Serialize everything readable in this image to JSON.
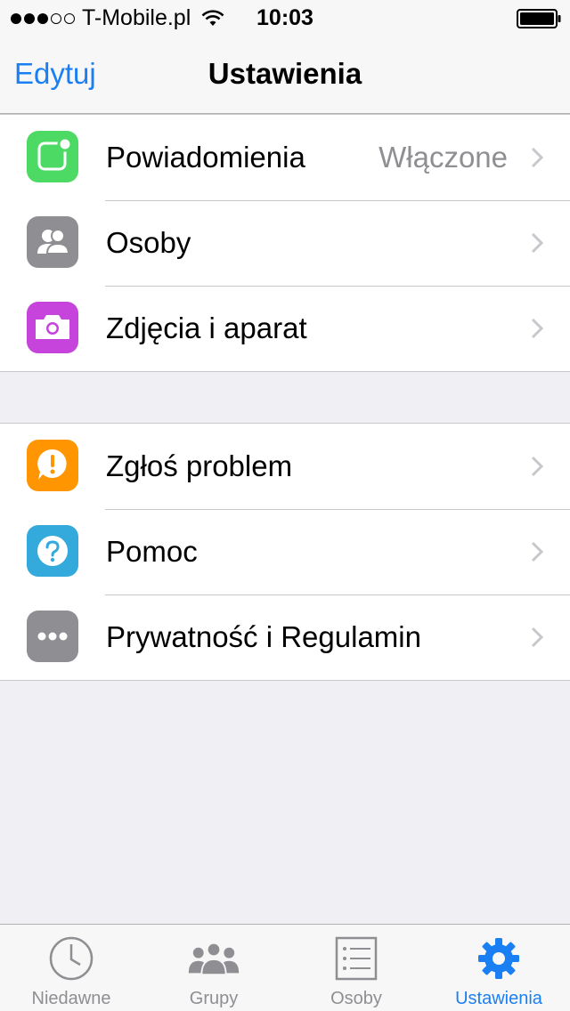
{
  "status_bar": {
    "signal_filled": 3,
    "signal_empty": 2,
    "carrier": "T-Mobile.pl",
    "time": "10:03"
  },
  "nav": {
    "left_button": "Edytuj",
    "title": "Ustawienia"
  },
  "groups": [
    {
      "items": [
        {
          "label": "Powiadomienia",
          "value": "Włączone",
          "icon": "notifications-icon",
          "color": "#4cd964"
        },
        {
          "label": "Osoby",
          "value": "",
          "icon": "contacts-icon",
          "color": "#8e8e93"
        },
        {
          "label": "Zdjęcia i aparat",
          "value": "",
          "icon": "camera-icon",
          "color": "#c644dc"
        }
      ]
    },
    {
      "items": [
        {
          "label": "Zgłoś problem",
          "value": "",
          "icon": "report-problem-icon",
          "color": "#ff9500"
        },
        {
          "label": "Pomoc",
          "value": "",
          "icon": "help-icon",
          "color": "#34aadc"
        },
        {
          "label": "Prywatność i Regulamin",
          "value": "",
          "icon": "more-icon",
          "color": "#8e8e93"
        }
      ]
    }
  ],
  "tabs": [
    {
      "label": "Niedawne",
      "icon": "clock-icon",
      "active": false
    },
    {
      "label": "Grupy",
      "icon": "groups-icon",
      "active": false
    },
    {
      "label": "Osoby",
      "icon": "contacts-list-icon",
      "active": false
    },
    {
      "label": "Ustawienia",
      "icon": "gear-icon",
      "active": true
    }
  ],
  "colors": {
    "accent": "#1a7ff2",
    "background": "#efeff4",
    "secondary_text": "#8e8e93"
  }
}
